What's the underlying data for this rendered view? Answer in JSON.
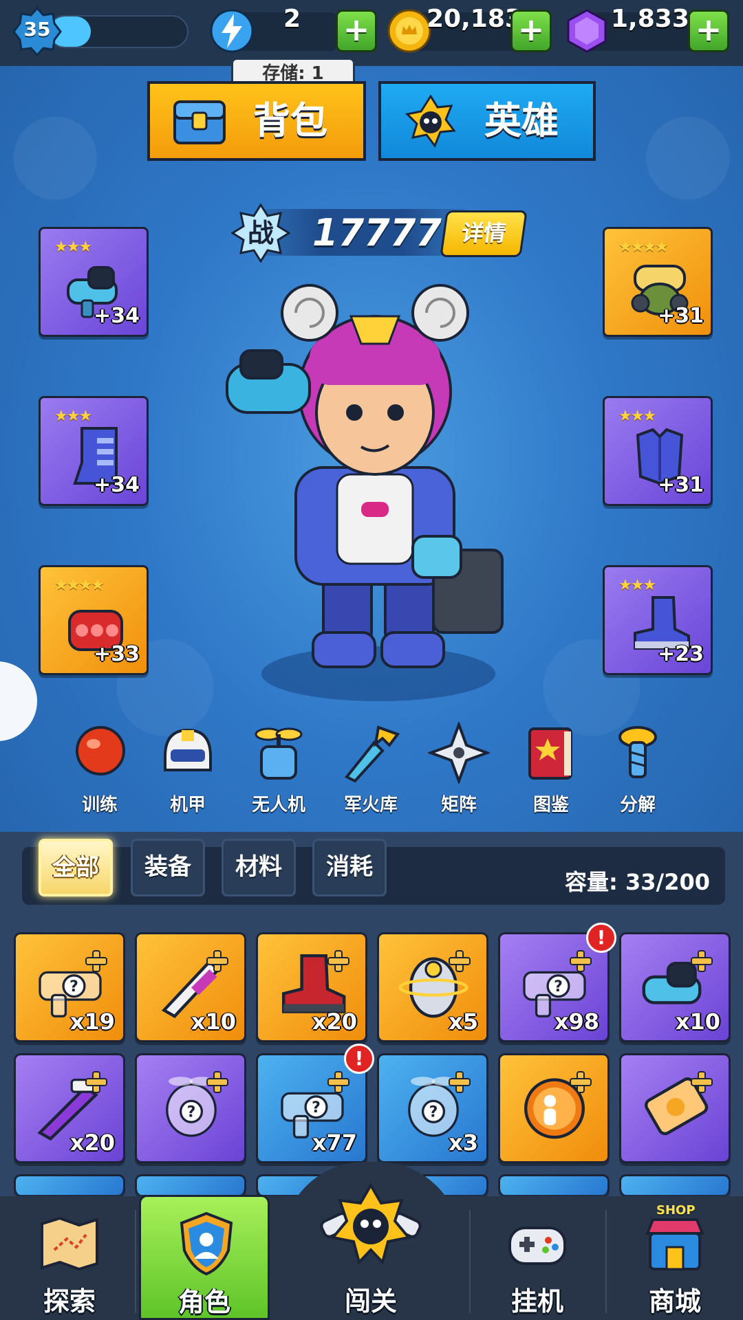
{
  "topbar": {
    "level": "35",
    "xp_progress": 0.3,
    "energy": {
      "value": "2",
      "icon": "lightning-icon",
      "tooltip": "存储: 1"
    },
    "coins": {
      "value": "20,183",
      "icon": "coin-icon"
    },
    "gems": {
      "value": "1,833",
      "icon": "gem-icon"
    },
    "plus_label": "+"
  },
  "main_tabs": {
    "bag": {
      "label": "背包",
      "icon": "chest-icon"
    },
    "hero": {
      "label": "英雄",
      "icon": "hero-badge-icon"
    }
  },
  "power": {
    "badge": "战",
    "value": "17777",
    "details_label": "详情"
  },
  "equipment": {
    "left": [
      {
        "icon": "gun-icon",
        "stars": "★★★",
        "level": "+34",
        "rarity": "purple"
      },
      {
        "icon": "armor-leg-icon",
        "stars": "★★★",
        "level": "+34",
        "rarity": "purple"
      },
      {
        "icon": "glove-icon",
        "stars": "★★★★",
        "level": "+33",
        "rarity": "orange"
      }
    ],
    "right": [
      {
        "icon": "gas-mask-icon",
        "stars": "★★★★",
        "level": "+31",
        "rarity": "orange"
      },
      {
        "icon": "chest-armor-icon",
        "stars": "★★★",
        "level": "+31",
        "rarity": "purple"
      },
      {
        "icon": "boot-icon",
        "stars": "★★★",
        "level": "+23",
        "rarity": "purple"
      }
    ]
  },
  "functions": [
    {
      "label": "训练",
      "icon": "boxing-glove-icon"
    },
    {
      "label": "机甲",
      "icon": "mech-helmet-icon"
    },
    {
      "label": "无人机",
      "icon": "drone-icon"
    },
    {
      "label": "军火库",
      "icon": "weapon-upgrade-icon"
    },
    {
      "label": "矩阵",
      "icon": "shuriken-icon"
    },
    {
      "label": "图鉴",
      "icon": "book-icon"
    },
    {
      "label": "分解",
      "icon": "screw-icon"
    }
  ],
  "inventory": {
    "filters": [
      "全部",
      "装备",
      "材料",
      "消耗"
    ],
    "active_filter": "全部",
    "capacity": "容量: 33/200",
    "items": [
      {
        "qty": "x19",
        "rarity": "orange",
        "icon": "mystery-gun-icon",
        "alert": false
      },
      {
        "qty": "x10",
        "rarity": "orange",
        "icon": "blade-gun-icon",
        "alert": false
      },
      {
        "qty": "x20",
        "rarity": "orange",
        "icon": "boot-icon",
        "alert": false
      },
      {
        "qty": "x5",
        "rarity": "orange",
        "icon": "shield-icon",
        "alert": false
      },
      {
        "qty": "x98",
        "rarity": "purple",
        "icon": "mystery-gun-icon",
        "alert": true
      },
      {
        "qty": "x10",
        "rarity": "purple",
        "icon": "gun-icon",
        "alert": false
      },
      {
        "qty": "x20",
        "rarity": "purple",
        "icon": "rifle-icon",
        "alert": false
      },
      {
        "qty": "",
        "rarity": "purple",
        "icon": "mystery-drone-icon",
        "alert": false
      },
      {
        "qty": "x77",
        "rarity": "blue",
        "icon": "mystery-gun-icon",
        "alert": true
      },
      {
        "qty": "x3",
        "rarity": "blue",
        "icon": "mystery-drone-icon",
        "alert": false
      },
      {
        "qty": "",
        "rarity": "orange",
        "icon": "hero-token-icon",
        "alert": false
      },
      {
        "qty": "",
        "rarity": "purple",
        "icon": "ticket-icon",
        "alert": false
      }
    ],
    "alert_mark": "!"
  },
  "bottom_nav": [
    {
      "label": "探索",
      "icon": "map-icon",
      "active": false
    },
    {
      "label": "角色",
      "icon": "character-shield-icon",
      "active": true
    },
    {
      "label": "闯关",
      "icon": "stage-badge-icon",
      "active": false
    },
    {
      "label": "挂机",
      "icon": "gamepad-icon",
      "active": false
    },
    {
      "label": "商城",
      "icon": "shop-icon",
      "active": false,
      "badge": "SHOP"
    }
  ],
  "colors": {
    "accent_green": "#5ec428",
    "orange_rarity": "#f5a623",
    "purple_rarity": "#7b55e0",
    "blue_rarity": "#3a95e0",
    "alert_red": "#e02424"
  }
}
